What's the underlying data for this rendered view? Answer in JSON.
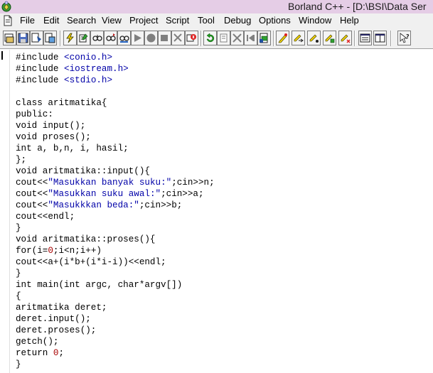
{
  "titlebar": {
    "title": "Borland C++ - [D:\\BSI\\Data Ser"
  },
  "menubar": {
    "items": [
      "File",
      "Edit",
      "Search",
      "View",
      "Project",
      "Script",
      "Tool",
      "Debug",
      "Options",
      "Window",
      "Help"
    ]
  },
  "toolbar": {
    "buttons": [
      "project-open-icon",
      "project-save-icon",
      "project-build-icon",
      "project-make-icon",
      "lightning-icon",
      "edit-icon",
      "find-icon",
      "find-next-icon",
      "run-icon",
      "pause-icon",
      "stop-icon",
      "undo-icon",
      "cancel-icon",
      "step-icon",
      "inspect-icon",
      "breakpoint-icon",
      "breakpoint-add-icon",
      "breakpoint-toggle-icon",
      "breakpoint-watch-icon",
      "window-tile-icon",
      "window-cascade-icon",
      "help-icon"
    ]
  },
  "editor": {
    "colors": {
      "string": "#0000a8",
      "number": "#a80000",
      "text": "#000000"
    },
    "lines": [
      [
        {
          "t": "#include "
        },
        {
          "t": "<conio.h>",
          "s": "str"
        }
      ],
      [
        {
          "t": "#include "
        },
        {
          "t": "<iostream.h>",
          "s": "str"
        }
      ],
      [
        {
          "t": "#include "
        },
        {
          "t": "<stdio.h>",
          "s": "str"
        }
      ],
      [],
      [
        {
          "t": "class aritmatika{"
        }
      ],
      [
        {
          "t": "public:"
        }
      ],
      [
        {
          "t": "void input();"
        }
      ],
      [
        {
          "t": "void proses();"
        }
      ],
      [
        {
          "t": "int a, b,n, i, hasil;"
        }
      ],
      [
        {
          "t": "};"
        }
      ],
      [
        {
          "t": "void aritmatika::input(){"
        }
      ],
      [
        {
          "t": "cout<<"
        },
        {
          "t": "\"Masukkan banyak suku:\"",
          "s": "str"
        },
        {
          "t": ";cin>>n;"
        }
      ],
      [
        {
          "t": "cout<<"
        },
        {
          "t": "\"Masukkan suku awal:\"",
          "s": "str"
        },
        {
          "t": ";cin>>a;"
        }
      ],
      [
        {
          "t": "cout<<"
        },
        {
          "t": "\"Masukkkan beda:\"",
          "s": "str"
        },
        {
          "t": ";cin>>b;"
        }
      ],
      [
        {
          "t": "cout<<endl;"
        }
      ],
      [
        {
          "t": "}"
        }
      ],
      [
        {
          "t": "void aritmatika::proses(){"
        }
      ],
      [
        {
          "t": "for(i="
        },
        {
          "t": "0",
          "s": "num"
        },
        {
          "t": ";i<n;i++)"
        }
      ],
      [
        {
          "t": "cout<<a+(i*b+(i*i-i))<<endl;"
        }
      ],
      [
        {
          "t": "}"
        }
      ],
      [
        {
          "t": "int main(int argc, char*argv[])"
        }
      ],
      [
        {
          "t": "{"
        }
      ],
      [
        {
          "t": "aritmatika deret;"
        }
      ],
      [
        {
          "t": "deret.input();"
        }
      ],
      [
        {
          "t": "deret.proses();"
        }
      ],
      [
        {
          "t": "getch();"
        }
      ],
      [
        {
          "t": "return "
        },
        {
          "t": "0",
          "s": "num"
        },
        {
          "t": ";"
        }
      ],
      [
        {
          "t": "}"
        }
      ]
    ]
  }
}
